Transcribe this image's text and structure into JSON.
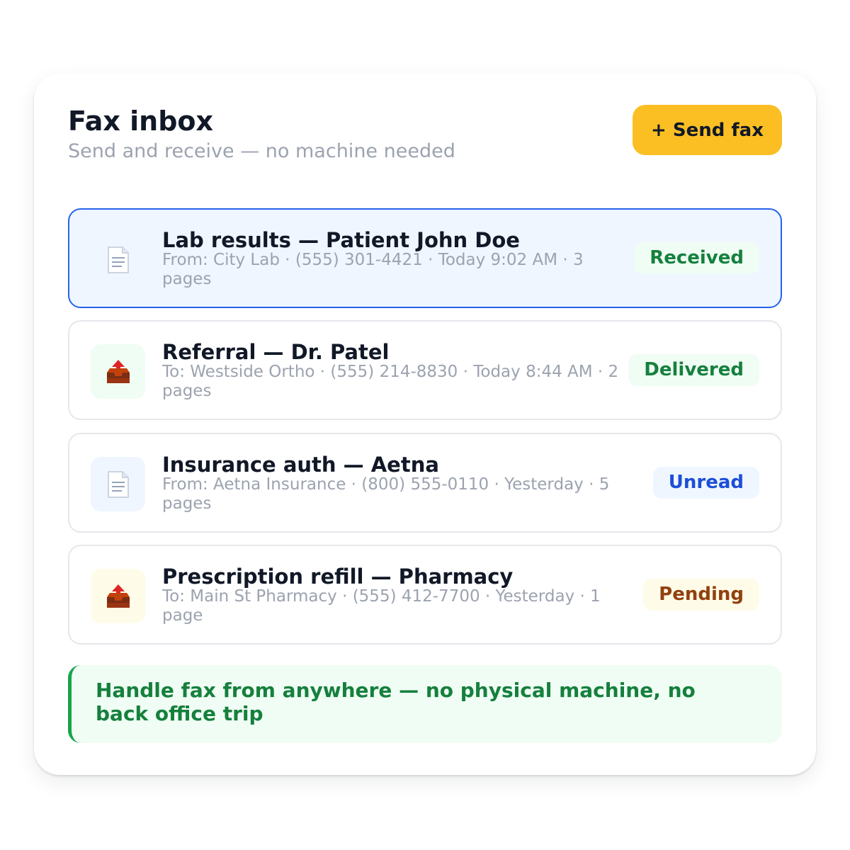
{
  "header": {
    "title": "Fax inbox",
    "subtitle": "Send and receive — no machine needed",
    "send_button_label": "+ Send fax"
  },
  "faxes": [
    {
      "title": "Lab results — Patient John Doe",
      "meta": "From: City Lab · (555) 301-4421 · Today 9:02 AM · 3 pages",
      "status": "Received",
      "direction": "incoming",
      "icon": "document-icon",
      "selected": true,
      "colors": {
        "badge_bg": "#f0fdf4",
        "badge_text": "#15803d",
        "icon_bg": "#eff6ff"
      }
    },
    {
      "title": "Referral — Dr. Patel",
      "meta": "To: Westside Ortho · (555) 214-8830 · Today 8:44 AM · 2 pages",
      "status": "Delivered",
      "direction": "outgoing",
      "icon": "outbox-tray-icon",
      "selected": false,
      "colors": {
        "badge_bg": "#f0fdf4",
        "badge_text": "#15803d",
        "icon_bg": "#f0fdf4"
      }
    },
    {
      "title": "Insurance auth — Aetna",
      "meta": "From: Aetna Insurance · (800) 555-0110 · Yesterday · 5 pages",
      "status": "Unread",
      "direction": "incoming",
      "icon": "document-icon",
      "selected": false,
      "colors": {
        "badge_bg": "#eff6ff",
        "badge_text": "#1d4ed8",
        "icon_bg": "#eff6ff"
      }
    },
    {
      "title": "Prescription refill — Pharmacy",
      "meta": "To: Main St Pharmacy · (555) 412-7700 · Yesterday · 1 page",
      "status": "Pending",
      "direction": "outgoing",
      "icon": "outbox-tray-icon",
      "selected": false,
      "colors": {
        "badge_bg": "#fefce8",
        "badge_text": "#92400e",
        "icon_bg": "#fefce8"
      }
    }
  ],
  "note": {
    "text": "Handle fax from anywhere — no physical machine, no back office trip"
  },
  "theme": {
    "accent": "#fbbf24",
    "selected_border": "#2563eb",
    "selected_bg": "#eff6ff",
    "note_accent": "#16a34a"
  }
}
